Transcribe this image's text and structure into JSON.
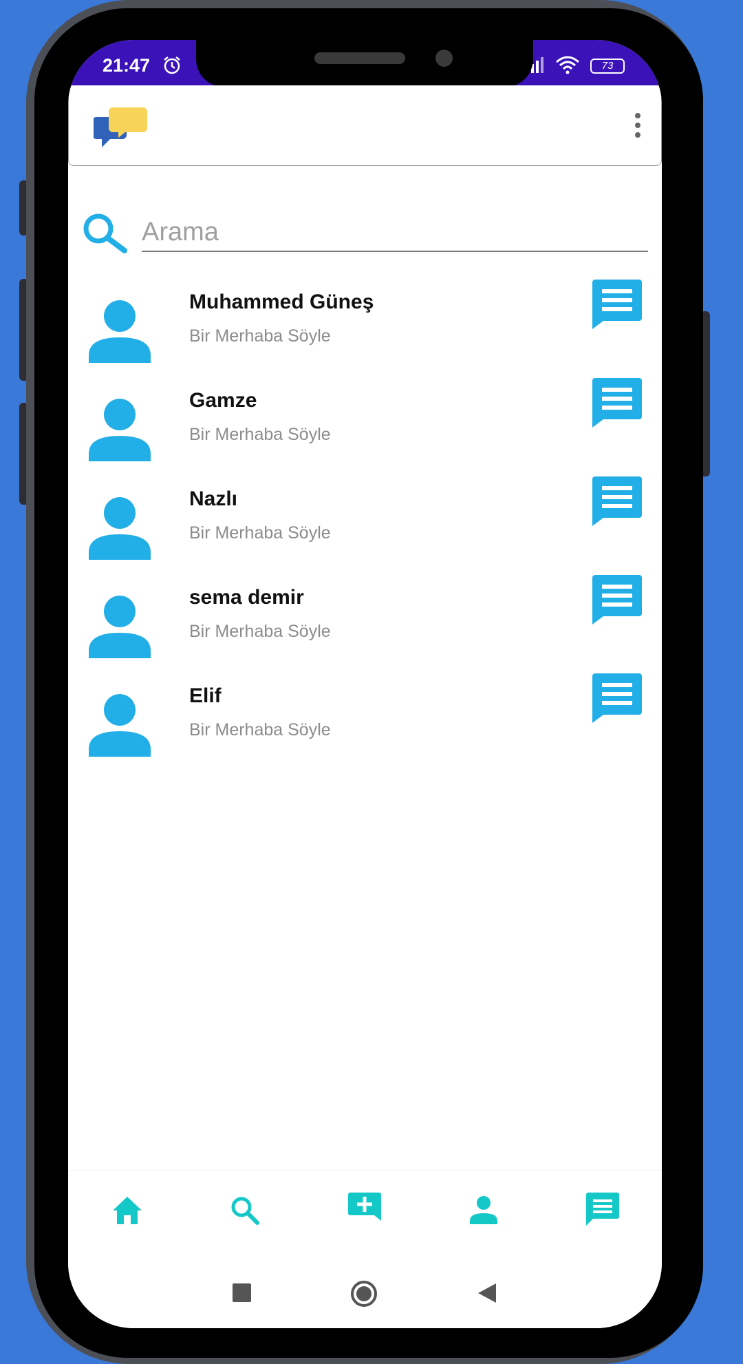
{
  "status_bar": {
    "time": "21:47",
    "battery": "73"
  },
  "app_bar": {
    "logo_icon": "chat-bubbles-logo-icon",
    "menu_icon": "more-vert-icon"
  },
  "search": {
    "placeholder": "Arama",
    "icon": "search-icon"
  },
  "contacts": [
    {
      "name": "Muhammed Güneş",
      "status": "Bir Merhaba Söyle"
    },
    {
      "name": "Gamze",
      "status": "Bir Merhaba Söyle"
    },
    {
      "name": "Nazlı",
      "status": "Bir Merhaba Söyle"
    },
    {
      "name": "sema demir",
      "status": "Bir Merhaba Söyle"
    },
    {
      "name": "Elif",
      "status": "Bir Merhaba Söyle"
    }
  ],
  "bottom_nav": [
    {
      "icon": "home-icon"
    },
    {
      "icon": "search-icon"
    },
    {
      "icon": "add-chat-icon"
    },
    {
      "icon": "person-icon"
    },
    {
      "icon": "message-icon"
    }
  ],
  "colors": {
    "accent": "#22aee6",
    "nav": "#14c8c8",
    "status_bar": "#3a12b8"
  }
}
